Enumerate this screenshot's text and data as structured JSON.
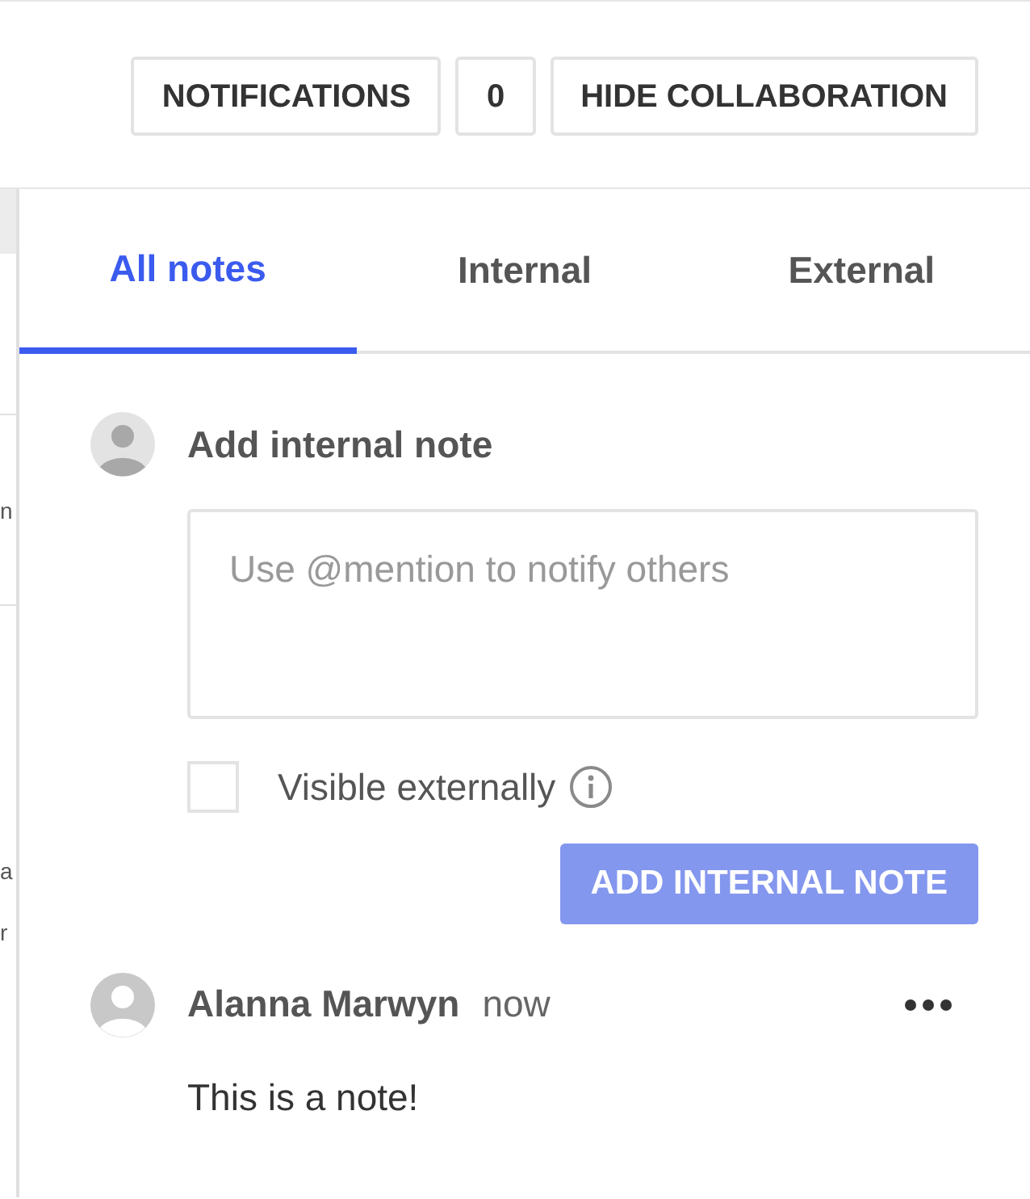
{
  "header": {
    "buttons": [
      {
        "label": "NOTIFICATIONS"
      },
      {
        "label": "0"
      },
      {
        "label": "HIDE COLLABORATION"
      }
    ]
  },
  "left_panel": {
    "fragments": [
      "n",
      "a",
      "r"
    ]
  },
  "tabs": [
    {
      "label": "All notes",
      "selected": true
    },
    {
      "label": "Internal",
      "selected": false
    },
    {
      "label": "External",
      "selected": false
    }
  ],
  "composer": {
    "title": "Add internal note",
    "placeholder": "Use @mention to notify others",
    "visible_externally": {
      "label": "Visible externally",
      "checked": false
    },
    "submit": {
      "label": "ADD INTERNAL NOTE",
      "disabled": true
    }
  },
  "notes": [
    {
      "author": "Alanna Marwyn",
      "time": "now",
      "text": "This is a note!"
    }
  ]
}
